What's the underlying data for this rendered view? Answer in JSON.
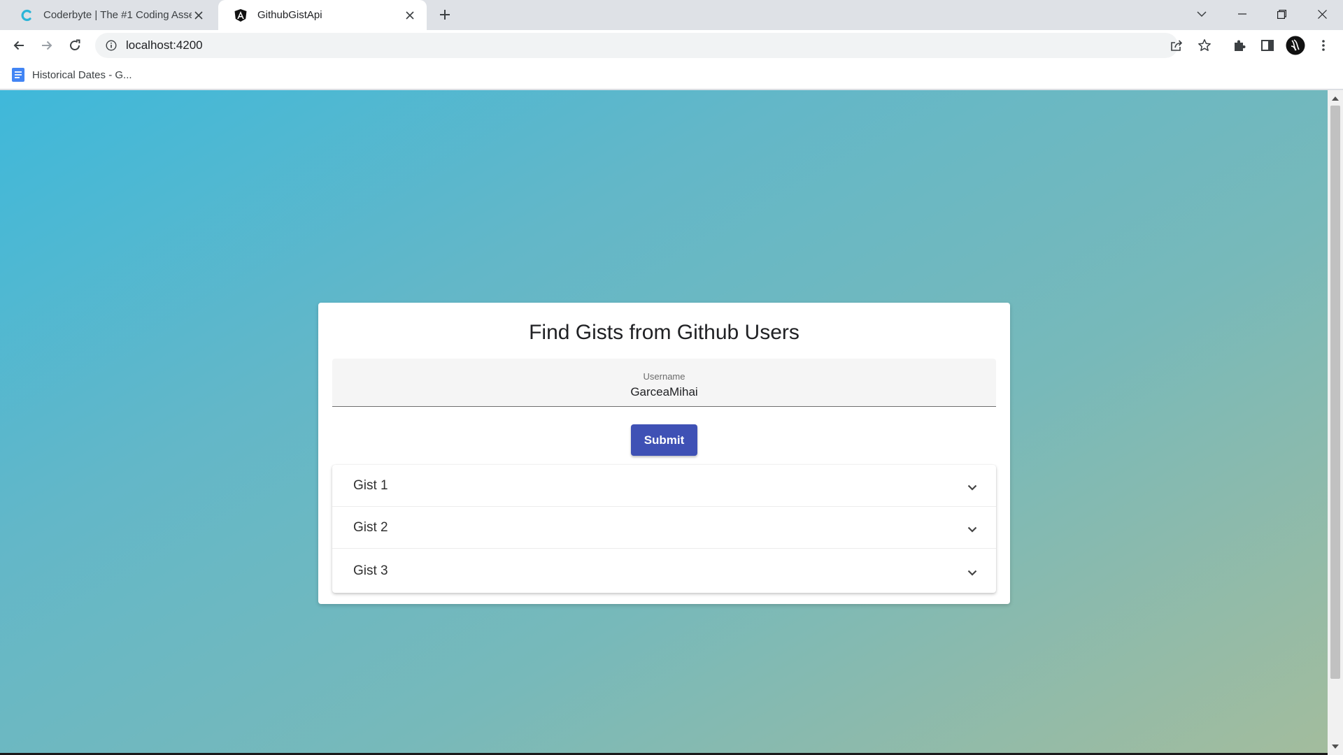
{
  "browser": {
    "tabs": [
      {
        "title": "Coderbyte | The #1 Coding Asses",
        "icon": "coderbyte-icon",
        "active": false
      },
      {
        "title": "GithubGistApi",
        "icon": "angular-icon",
        "active": true
      }
    ],
    "address": {
      "url": "localhost:4200"
    },
    "bookmarks": [
      {
        "label": "Historical Dates - G...",
        "icon": "google-docs-icon"
      }
    ]
  },
  "page": {
    "title": "Find Gists from Github Users",
    "username_field": {
      "label": "Username",
      "value": "GarceaMihai"
    },
    "submit_label": "Submit",
    "gists": [
      {
        "label": "Gist 1"
      },
      {
        "label": "Gist 2"
      },
      {
        "label": "Gist 3"
      }
    ],
    "colors": {
      "submit_button": "#3f51b5",
      "gradient_start": "#3fb8da",
      "gradient_end": "#a3bc9d"
    }
  }
}
